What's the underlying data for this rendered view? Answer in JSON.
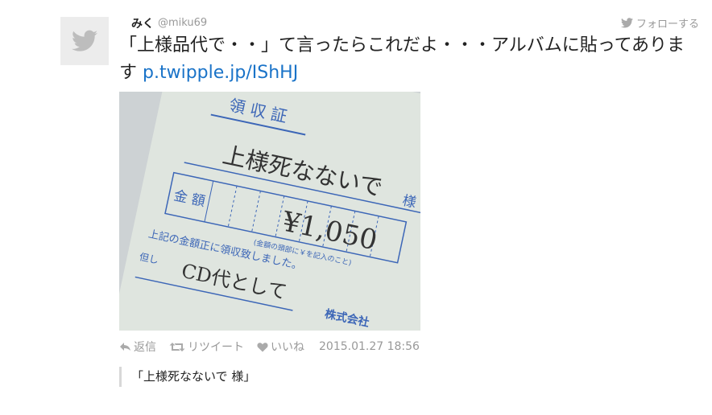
{
  "tweet": {
    "author_name": "みく",
    "author_handle": "@miku69",
    "follow_label": "フォローする",
    "text": "「上様品代で・・」て言ったらこれだよ・・・アルバムに貼ってあります",
    "link_text": "p.twipple.jp/IShHJ",
    "timestamp": "2015.01.27 18:56"
  },
  "actions": {
    "reply_label": "返信",
    "retweet_label": "リツイート",
    "like_label": "いいね"
  },
  "photo": {
    "title": "領 収 証",
    "name_line": "上様死なないで",
    "name_suffix": "様",
    "amount_label": "金 額",
    "amount": "¥1,050",
    "note_small": "(金額の頭部に￥を記入のこと)",
    "received_text": "上記の金額正に領収致しました。",
    "proviso_label": "但し",
    "proviso_value": "CD代として",
    "company": "株式会社"
  },
  "quote_text": "「上様死なないで 様」",
  "colors": {
    "link": "#1a73c8",
    "meta": "#999999",
    "receipt_paper": "#dfe5df",
    "receipt_ink": "#3c66b7"
  },
  "icons": [
    "twitter-bird-icon",
    "reply-icon",
    "retweet-icon",
    "heart-icon"
  ]
}
